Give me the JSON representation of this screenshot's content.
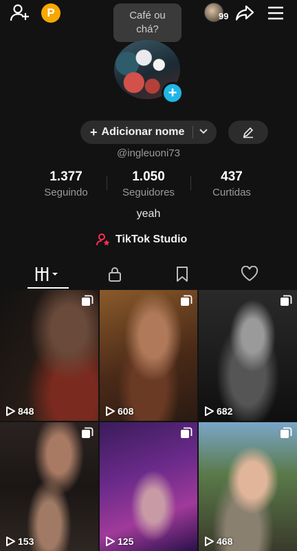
{
  "header": {
    "coin_letter": "P",
    "story_count": "99"
  },
  "bubble": {
    "line1": "Café ou",
    "line2": "chá?"
  },
  "profile": {
    "add_name_label": "Adicionar nome",
    "username": "@ingleuoni73",
    "bio": "yeah",
    "studio_label": "TikTok Studio"
  },
  "stats": [
    {
      "value": "1.377",
      "label": "Seguindo"
    },
    {
      "value": "1.050",
      "label": "Seguidores"
    },
    {
      "value": "437",
      "label": "Curtidas"
    }
  ],
  "tabs": [
    {
      "icon": "grid-icon"
    },
    {
      "icon": "lock-icon"
    },
    {
      "icon": "bookmark-icon"
    },
    {
      "icon": "heart-icon"
    }
  ],
  "videos": [
    {
      "views": "848"
    },
    {
      "views": "608"
    },
    {
      "views": "682"
    },
    {
      "views": "153"
    },
    {
      "views": "125"
    },
    {
      "views": "468"
    }
  ],
  "colors": {
    "background": "#121212",
    "accent_blue": "#1fb6e6",
    "coin": "#f6a800",
    "studio_icon": "#fe2c55"
  }
}
